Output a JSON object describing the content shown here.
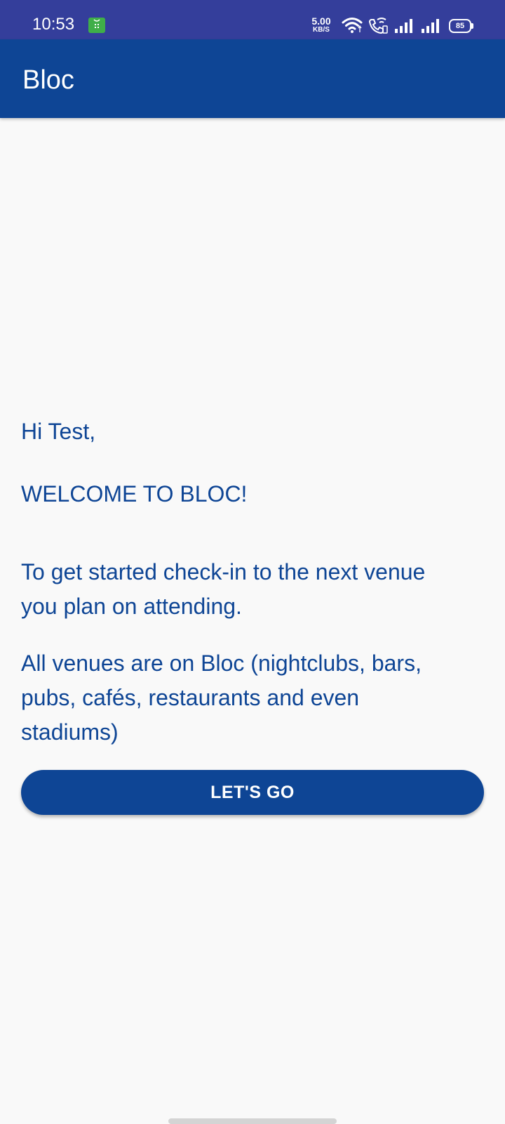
{
  "status_bar": {
    "time": "10:53",
    "network_speed_value": "5.00",
    "network_speed_unit": "KB/S",
    "battery_level": "85",
    "icons": [
      "app-notification-icon",
      "wifi-icon",
      "wifi-calling-icon",
      "signal-icon",
      "signal-icon",
      "battery-icon"
    ]
  },
  "app_bar": {
    "title": "Bloc"
  },
  "main": {
    "greeting": "Hi Test,",
    "welcome": "WELCOME TO BLOC!",
    "intro": "To get started check-in to the next venue you plan on attending.",
    "venues": "All venues are on Bloc (nightclubs, bars, pubs, cafés, restaurants and even stadiums)",
    "cta_label": "LET'S GO"
  },
  "colors": {
    "status_bar": "#343e9b",
    "primary": "#0e4595",
    "background": "#f9f9f9",
    "app_icon": "#3fae49"
  }
}
